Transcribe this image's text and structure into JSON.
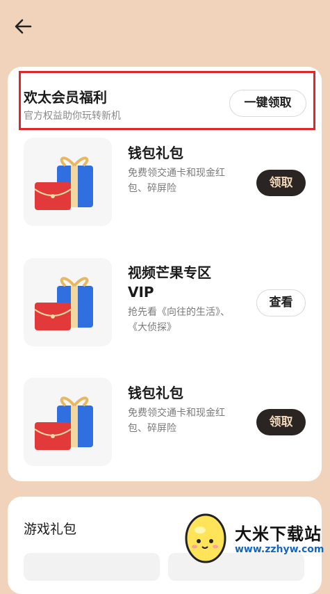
{
  "header": {
    "back_icon": "back-arrow-icon"
  },
  "benefits": {
    "title": "欢太会员福利",
    "subtitle": "官方权益助你玩转新机",
    "claim_all_label": "一键领取",
    "highlight_color": "#e0262b",
    "items": [
      {
        "icon": "gift-icon",
        "title": "钱包礼包",
        "desc": "免费领交通卡和现金红包、碎屏险",
        "action": "领取",
        "action_style": "dark"
      },
      {
        "icon": "gift-icon",
        "title": "视频芒果专区VIP",
        "desc": "抢先看《向往的生活》、《大侦探》",
        "action": "查看",
        "action_style": "outline"
      },
      {
        "icon": "gift-icon",
        "title": "钱包礼包",
        "desc": "免费领交通卡和现金红包、碎屏险",
        "action": "领取",
        "action_style": "dark"
      }
    ]
  },
  "games": {
    "title": "游戏礼包"
  },
  "watermark": {
    "title": "大米下载站",
    "url": "www.zzhyw.com"
  }
}
